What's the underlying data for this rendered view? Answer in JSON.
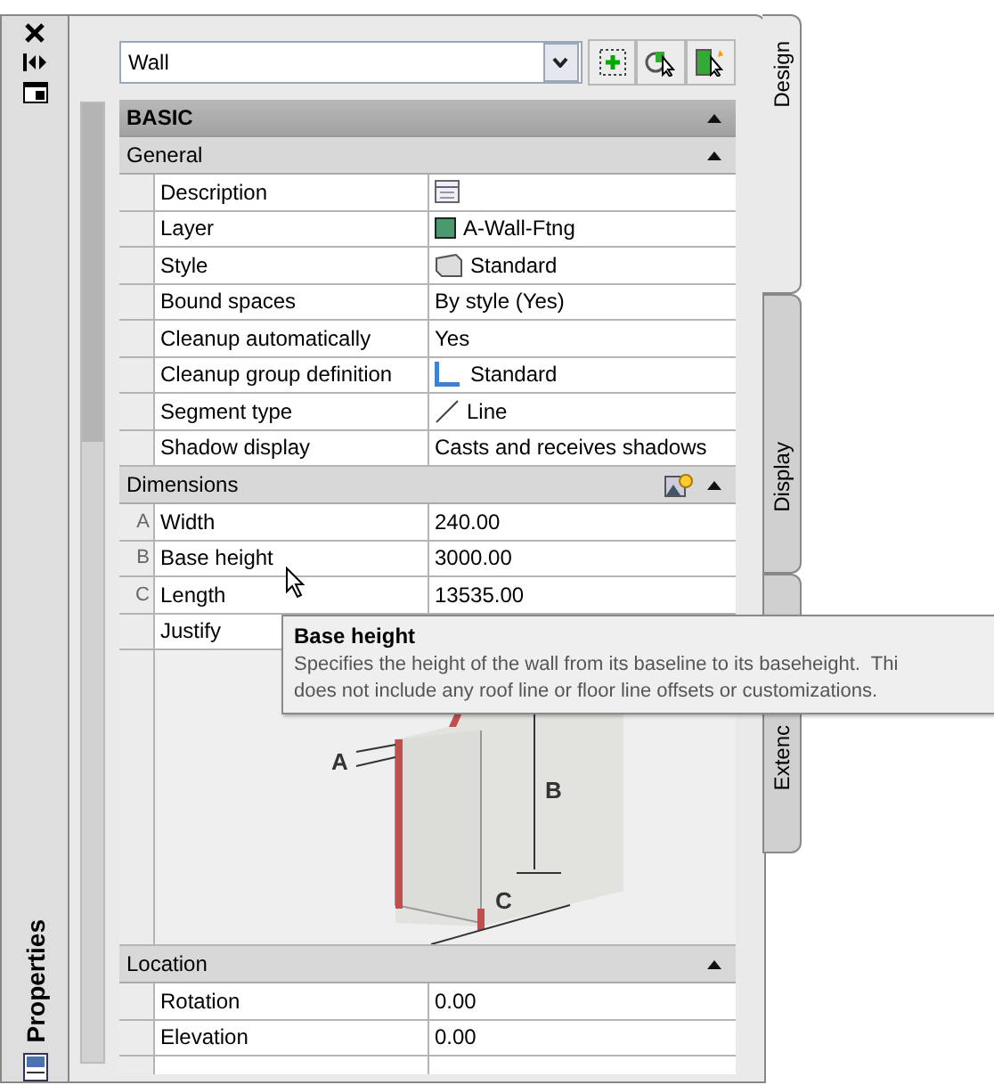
{
  "sidebar": {
    "title": "Properties"
  },
  "selector": {
    "value": "Wall"
  },
  "tabs": [
    {
      "label": "Design",
      "selected": true
    },
    {
      "label": "Display",
      "selected": false
    },
    {
      "label": "Extenc",
      "selected": false
    }
  ],
  "categories": [
    {
      "title": "BASIC",
      "expanded": true,
      "groups": [
        {
          "title": "General",
          "expanded": true,
          "rows": [
            {
              "label": "Description",
              "kind": "sheet"
            },
            {
              "label": "Layer",
              "kind": "swatch",
              "value": "A-Wall-Ftng"
            },
            {
              "label": "Style",
              "kind": "style",
              "value": "Standard"
            },
            {
              "label": "Bound spaces",
              "kind": "text",
              "value": "By style (Yes)"
            },
            {
              "label": "Cleanup automatically",
              "kind": "text",
              "value": "Yes"
            },
            {
              "label": "Cleanup group definition",
              "kind": "group",
              "value": "Standard"
            },
            {
              "label": "Segment type",
              "kind": "line",
              "value": "Line"
            },
            {
              "label": "Shadow display",
              "kind": "text",
              "value": "Casts and receives shadows"
            }
          ]
        },
        {
          "title": "Dimensions",
          "expanded": true,
          "tool_button": true,
          "rows": [
            {
              "marker": "A",
              "label": "Width",
              "kind": "text",
              "value": "240.00"
            },
            {
              "marker": "B",
              "label": "Base height",
              "kind": "text",
              "value": "3000.00"
            },
            {
              "marker": "C",
              "label": "Length",
              "kind": "text",
              "value": "13535.00"
            },
            {
              "label": "Justify",
              "kind": "text"
            }
          ],
          "diagram": {
            "labels": [
              "A",
              "B",
              "C"
            ]
          }
        },
        {
          "title": "Location",
          "expanded": true,
          "rows": [
            {
              "label": "Rotation",
              "kind": "text",
              "value": "0.00"
            },
            {
              "label": "Elevation",
              "kind": "text",
              "value": "0.00"
            }
          ]
        }
      ]
    }
  ],
  "tooltip": {
    "title": "Base height",
    "lines": [
      "Specifies the height of the wall from its baseline to its baseheight.  Thi",
      "does not include any roof line or floor line offsets or customizations."
    ]
  }
}
